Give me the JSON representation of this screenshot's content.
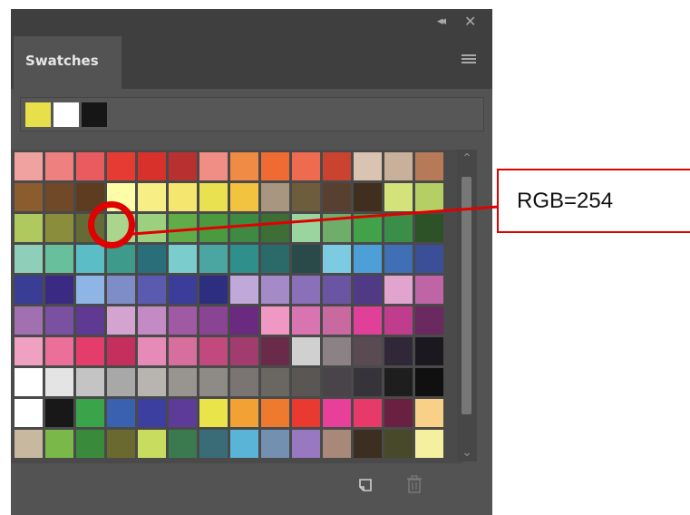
{
  "window": {
    "collapse_icon": "double-chevron-left-icon",
    "close_icon": "close-icon"
  },
  "tabs": [
    {
      "label": "Swatches"
    }
  ],
  "panel_menu_icon": "hamburger-menu-icon",
  "recent_swatches": [
    "#e8e04a",
    "#ffffff",
    "#161616"
  ],
  "swatches": [
    [
      "#f0a2a0",
      "#ef8080",
      "#e95b5e",
      "#e63b33",
      "#d8302b",
      "#b8302f",
      "#f08e86",
      "#f08b45",
      "#f06b34",
      "#ef6b50",
      "#c9432f",
      "#d8c4b0",
      "#c8b09a",
      "#b77a58"
    ],
    [
      "#8b5c2e",
      "#704a28",
      "#5e3c20",
      "#fffca8",
      "#f8ee86",
      "#f4e66e",
      "#e9e14f",
      "#f2c33f",
      "#a89680",
      "#6e5d3d",
      "#584030",
      "#402e1e",
      "#d4e27a",
      "#b6cf64"
    ],
    [
      "#b0c95e",
      "#8a8d3c",
      "#646b36",
      "#a9d58c",
      "#9ccf7e",
      "#61ab49",
      "#4c9a40",
      "#3f8a42",
      "#3c6e36",
      "#9ad49e",
      "#6eae6a",
      "#41a24a",
      "#3a8e48",
      "#2e5228"
    ],
    [
      "#8fcfba",
      "#68bf9b",
      "#5bbec6",
      "#3e9a8a",
      "#2a6e79",
      "#7bcccc",
      "#4ba5a1",
      "#2f8f8b",
      "#2a6b6a",
      "#2a4a4a",
      "#7ccbe0",
      "#4d9fd8",
      "#3f6fb4",
      "#3a4f98"
    ],
    [
      "#3a3d94",
      "#3a2a84",
      "#8fb4e6",
      "#7e8cc8",
      "#5a5ab0",
      "#3c3c9a",
      "#2e2e80",
      "#c0a8d8",
      "#a48bc8",
      "#8a70b8",
      "#6a55a2",
      "#503a86",
      "#e0a4cf",
      "#bf64a4"
    ],
    [
      "#a070b0",
      "#7a50a0",
      "#5e3a92",
      "#d4a4d0",
      "#c48ac4",
      "#a05aa4",
      "#8a4494",
      "#6a2a80",
      "#f098c4",
      "#d874b0",
      "#c86aa0",
      "#e04098",
      "#c03c8c",
      "#6a2a60"
    ],
    [
      "#f0a0c0",
      "#ec6f9a",
      "#e53d6b",
      "#c52f5d",
      "#e68bb8",
      "#d66f9e",
      "#c1497e",
      "#a23c6f",
      "#6a2a4a",
      "#d0d0d0",
      "#8c8286",
      "#5a4a52",
      "#302838",
      "#1c1820"
    ],
    [
      "#ffffff",
      "#e4e4e4",
      "#c4c4c4",
      "#a8a8a8",
      "#b8b4b0",
      "#989490",
      "#8e8a86",
      "#7a7572",
      "#6a6662",
      "#5a5654",
      "#48444a",
      "#36343a",
      "#1e1e1e",
      "#101010"
    ],
    [
      "#ffffff",
      "#181818",
      "#3aa44a",
      "#3a60b0",
      "#3c3ea0",
      "#5c3c98",
      "#e8e44a",
      "#f2a234",
      "#ee7a30",
      "#e83a30",
      "#e84098",
      "#e83a6a",
      "#6a2040",
      "#f8d088"
    ],
    [
      "#c8b8a0",
      "#7ab84a",
      "#3a8a3c",
      "#6a6a30",
      "#c8dc60",
      "#3a7a4e",
      "#3a6c78",
      "#5ab4d8",
      "#7490b0",
      "#9878c0",
      "#a88878",
      "#3c2e20",
      "#48482a",
      "#f4f0a0"
    ]
  ],
  "toolbar": {
    "new_swatch_icon": "new-swatch-icon",
    "trash_icon": "trash-icon"
  },
  "annotation": {
    "callout_text": "RGB=254",
    "color": "#e00000"
  }
}
